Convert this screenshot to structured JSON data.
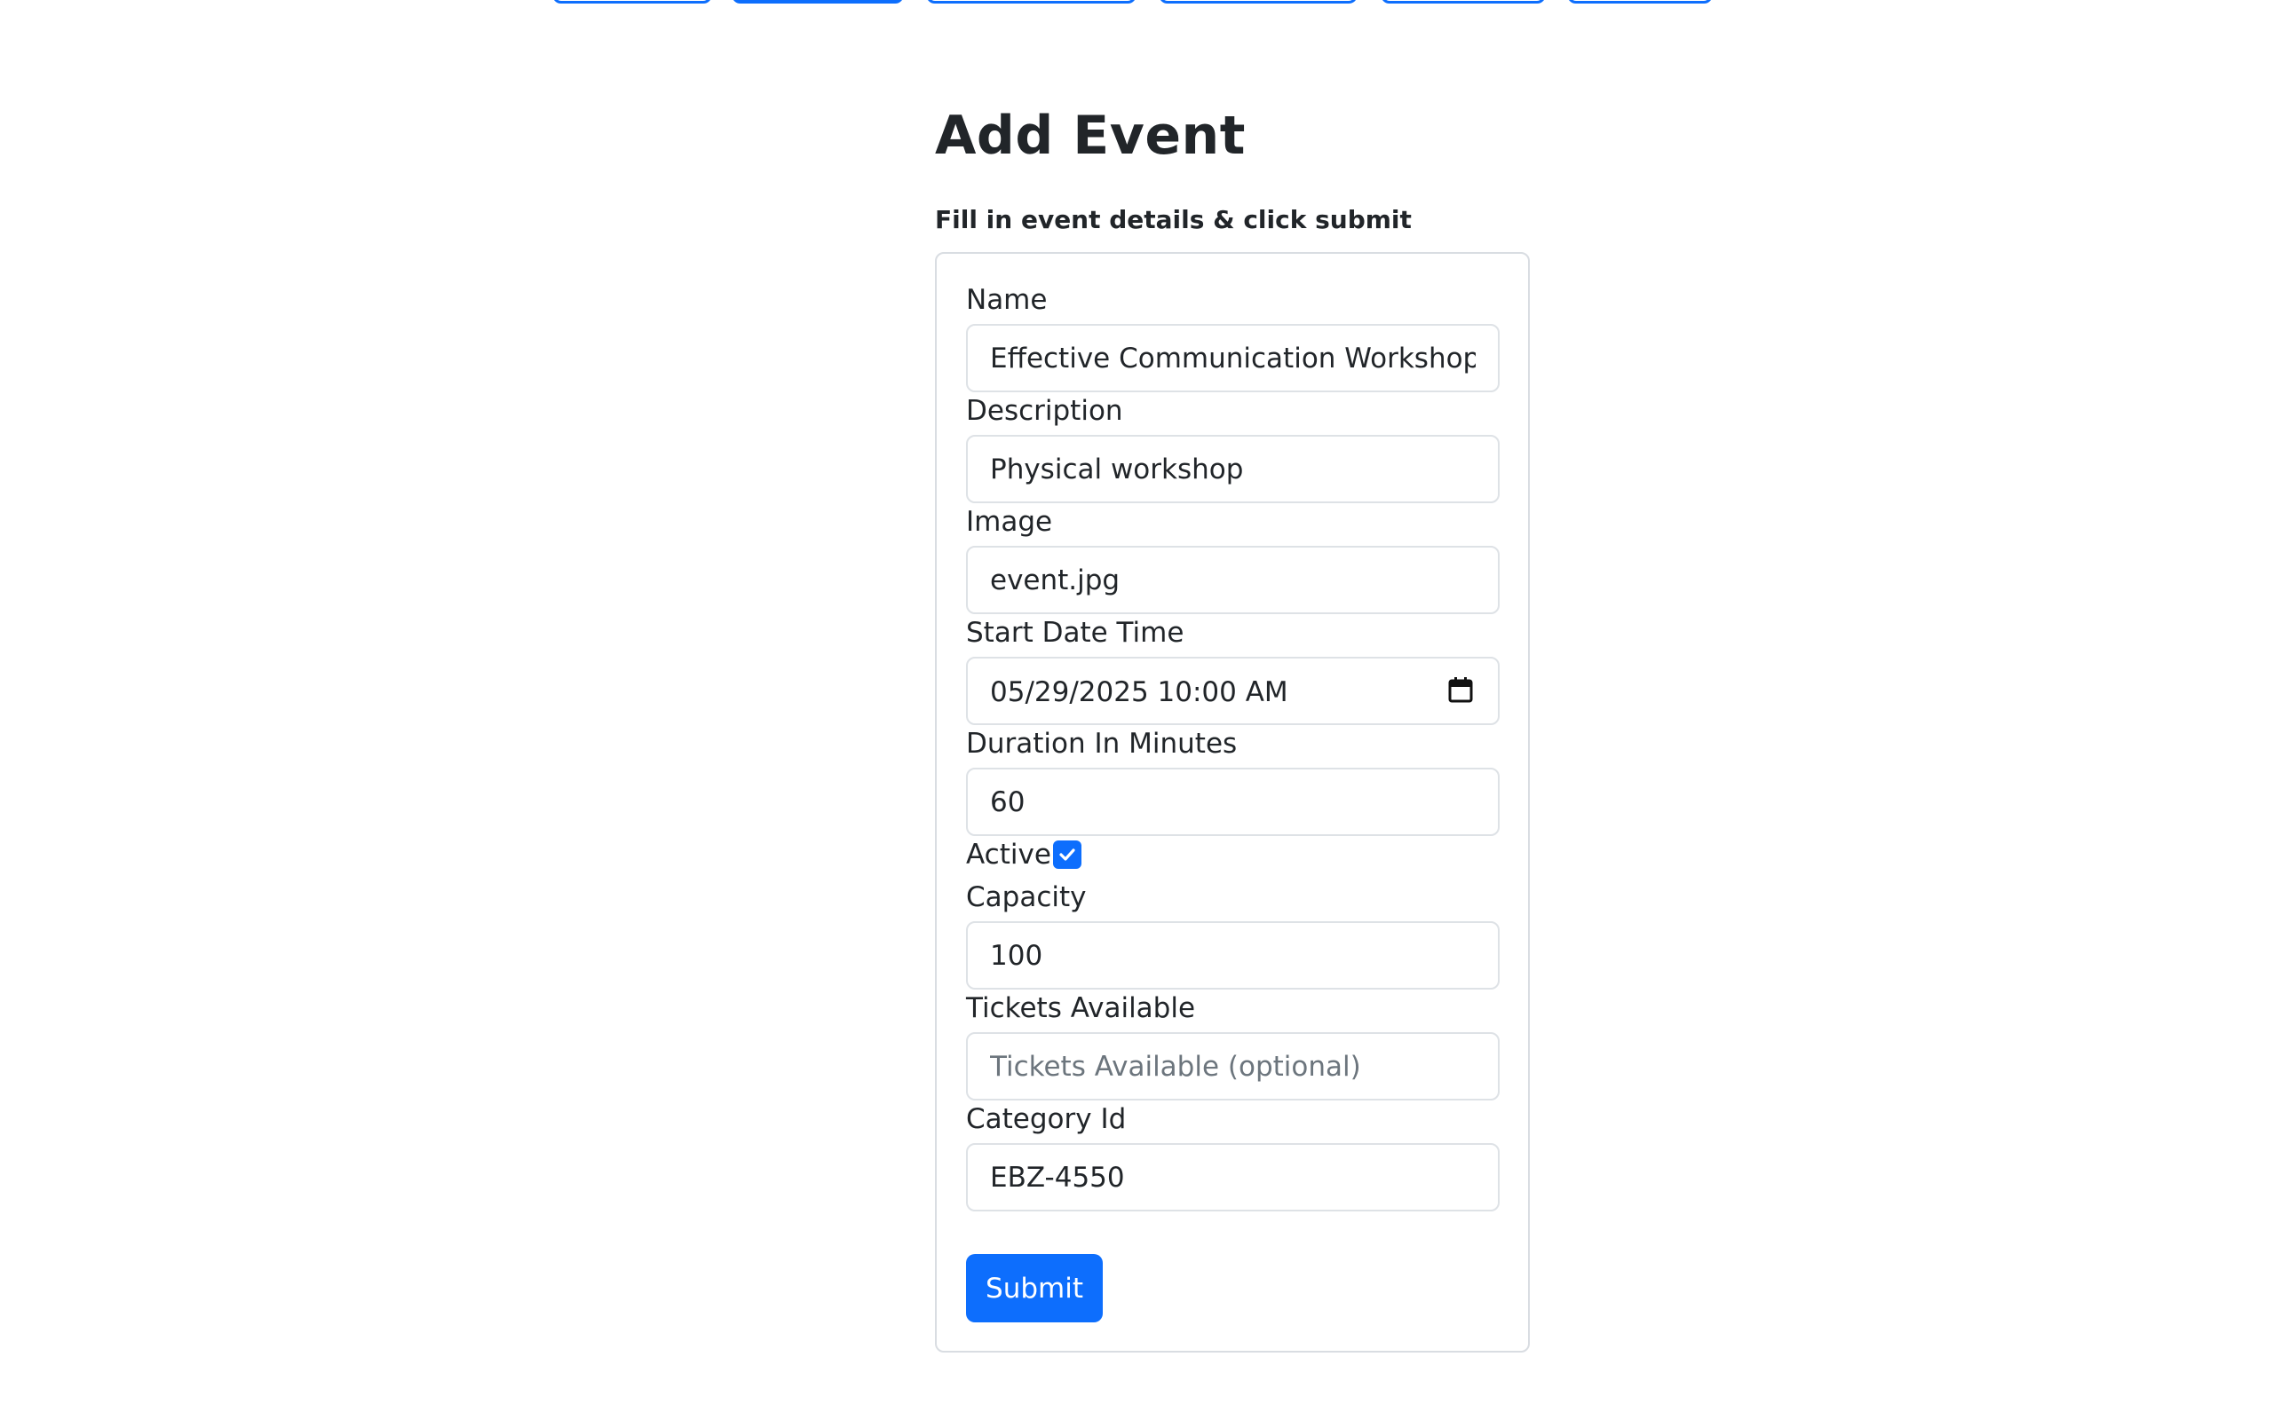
{
  "page": {
    "title": "Add Event",
    "subtitle": "Fill in event details & click submit"
  },
  "form": {
    "name": {
      "label": "Name",
      "value": "Effective Communication Workshop"
    },
    "description": {
      "label": "Description",
      "value": "Physical workshop"
    },
    "image": {
      "label": "Image",
      "value": "event.jpg"
    },
    "start_date_time": {
      "label": "Start Date Time",
      "value": "05/29/2025 10:00  AM"
    },
    "duration": {
      "label": "Duration In Minutes",
      "value": "60"
    },
    "active": {
      "label": "Active",
      "checked": true
    },
    "capacity": {
      "label": "Capacity",
      "value": "100"
    },
    "tickets_available": {
      "label": "Tickets Available",
      "value": "",
      "placeholder": "Tickets Available (optional)"
    },
    "category_id": {
      "label": "Category Id",
      "value": "EBZ-4550"
    },
    "submit_label": "Submit"
  },
  "colors": {
    "primary": "#0d6efd",
    "text": "#212529",
    "border": "#dee2e6",
    "placeholder": "#6c757d"
  },
  "icons": {
    "calendar": "calendar-icon",
    "checkbox": "check-icon"
  }
}
